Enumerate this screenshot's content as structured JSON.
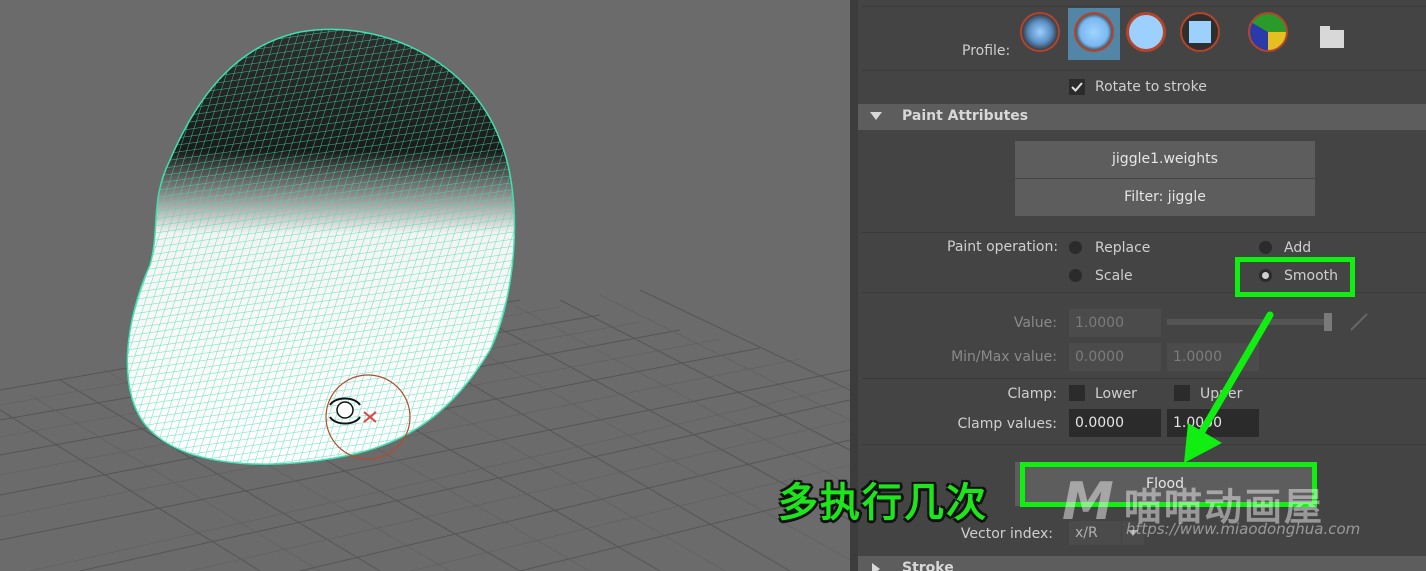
{
  "profile": {
    "label": "Profile:",
    "brushes": [
      "soft-brush-icon",
      "soft-brush-selected-icon",
      "solid-circle-icon",
      "solid-square-icon",
      "artisan-brush-icon",
      "folder-icon"
    ]
  },
  "rotate_to_stroke": {
    "label": "Rotate to stroke",
    "checked": true
  },
  "paint_attributes": {
    "title": "Paint Attributes",
    "attribute_button": "jiggle1.weights",
    "filter_button": "Filter: jiggle",
    "operation": {
      "label": "Paint operation:",
      "options": [
        "Replace",
        "Add",
        "Scale",
        "Smooth"
      ],
      "selected": "Smooth"
    },
    "value": {
      "label": "Value:",
      "value": "1.0000",
      "slider": 1.0
    },
    "minmax": {
      "label": "Min/Max value:",
      "min": "0.0000",
      "max": "1.0000"
    },
    "clamp": {
      "label": "Clamp:",
      "lower": "Lower",
      "upper": "Upper"
    },
    "clamp_values": {
      "label": "Clamp values:",
      "low": "0.0000",
      "high": "1.0000"
    },
    "flood_button": "Flood",
    "vector_index": {
      "label": "Vector index:",
      "value": "x/R"
    }
  },
  "stroke_section": {
    "title": "Stroke"
  },
  "annotation": {
    "caption": "多执行几次",
    "color": "#11ee11"
  },
  "watermark": {
    "logo": "M",
    "name": "喵喵动画屋",
    "url": "https://www.miaodonghua.com"
  },
  "colors": {
    "viewport_bg": "#6b6b6b",
    "wire": "#3ee0b0",
    "panel_bg": "#444444",
    "selected": "#5285a6"
  }
}
